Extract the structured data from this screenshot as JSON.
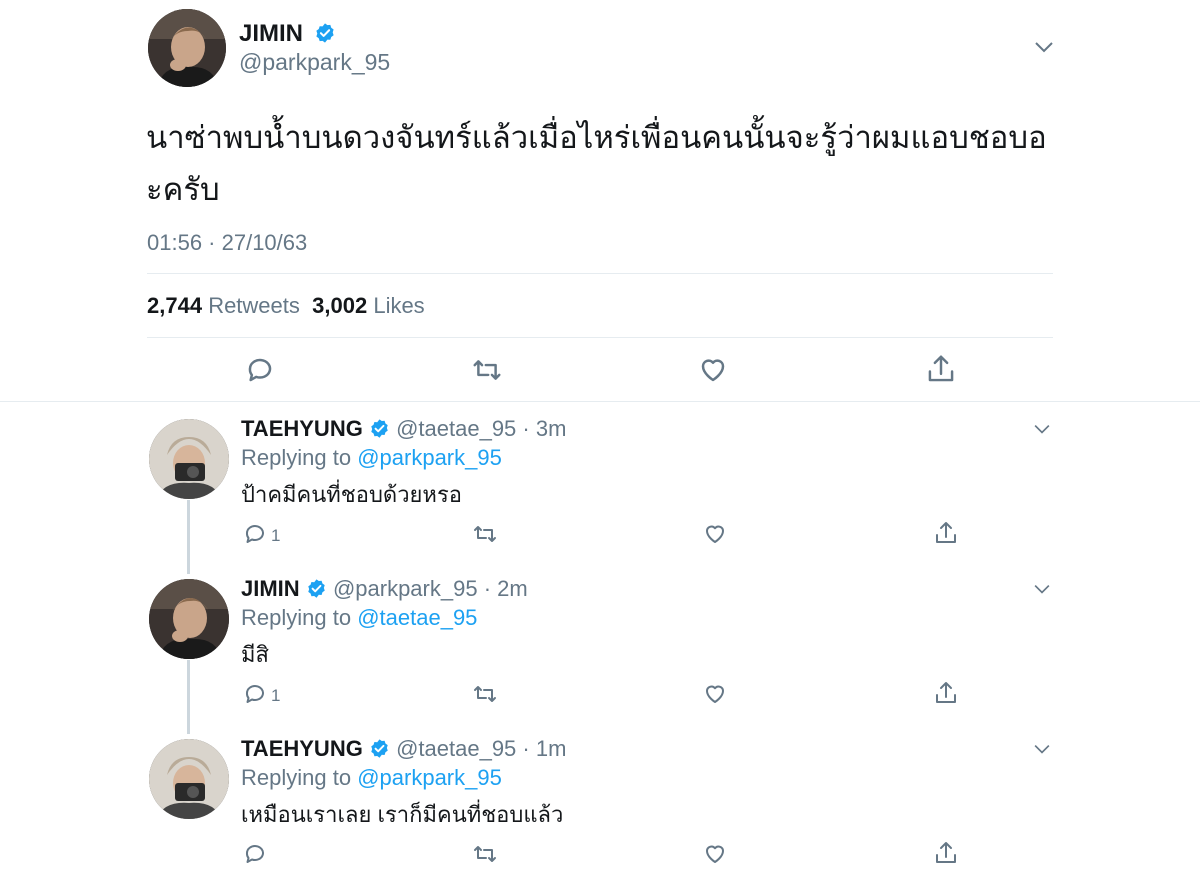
{
  "main_tweet": {
    "display_name": "JIMIN",
    "handle": "@parkpark_95",
    "text": "นาซ่าพบน้ำบนดวงจันทร์แล้วเมื่อไหร่เพื่อนคนนั้นจะรู้ว่าผมแอบชอบอะครับ",
    "timestamp": "01:56 · 27/10/63",
    "retweets_count": "2,744",
    "retweets_label": "Retweets",
    "likes_count": "3,002",
    "likes_label": "Likes"
  },
  "replies": [
    {
      "display_name": "TAEHYUNG",
      "handle": "@taetae_95",
      "time": "3m",
      "replying_label": "Replying to",
      "replying_to": "@parkpark_95",
      "text": "ป้าคมีคนที่ชอบด้วยหรอ",
      "reply_count": "1"
    },
    {
      "display_name": "JIMIN",
      "handle": "@parkpark_95",
      "time": "2m",
      "replying_label": "Replying to",
      "replying_to": "@taetae_95",
      "text": "มีสิ",
      "reply_count": "1"
    },
    {
      "display_name": "TAEHYUNG",
      "handle": "@taetae_95",
      "time": "1m",
      "replying_label": "Replying to",
      "replying_to": "@parkpark_95",
      "text": "เหมือนเราเลย เราก็มีคนที่ชอบแล้ว",
      "reply_count": ""
    }
  ],
  "colors": {
    "verified": "#1da1f2",
    "link": "#1da1f2",
    "muted": "#657786",
    "divider": "#e6ecf0"
  },
  "icons": [
    "verified-badge-icon",
    "chevron-down-icon",
    "reply-icon",
    "retweet-icon",
    "like-icon",
    "share-icon"
  ]
}
